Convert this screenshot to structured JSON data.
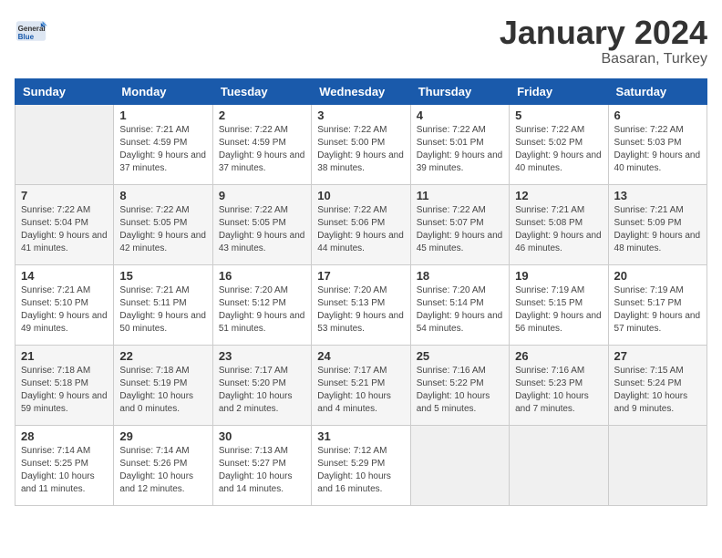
{
  "header": {
    "logo": {
      "general": "General",
      "blue": "Blue"
    },
    "title": "January 2024",
    "subtitle": "Basaran, Turkey"
  },
  "columns": [
    "Sunday",
    "Monday",
    "Tuesday",
    "Wednesday",
    "Thursday",
    "Friday",
    "Saturday"
  ],
  "weeks": [
    [
      {
        "day": "",
        "sunrise": "",
        "sunset": "",
        "daylight": ""
      },
      {
        "day": "1",
        "sunrise": "Sunrise: 7:21 AM",
        "sunset": "Sunset: 4:59 PM",
        "daylight": "Daylight: 9 hours and 37 minutes."
      },
      {
        "day": "2",
        "sunrise": "Sunrise: 7:22 AM",
        "sunset": "Sunset: 4:59 PM",
        "daylight": "Daylight: 9 hours and 37 minutes."
      },
      {
        "day": "3",
        "sunrise": "Sunrise: 7:22 AM",
        "sunset": "Sunset: 5:00 PM",
        "daylight": "Daylight: 9 hours and 38 minutes."
      },
      {
        "day": "4",
        "sunrise": "Sunrise: 7:22 AM",
        "sunset": "Sunset: 5:01 PM",
        "daylight": "Daylight: 9 hours and 39 minutes."
      },
      {
        "day": "5",
        "sunrise": "Sunrise: 7:22 AM",
        "sunset": "Sunset: 5:02 PM",
        "daylight": "Daylight: 9 hours and 40 minutes."
      },
      {
        "day": "6",
        "sunrise": "Sunrise: 7:22 AM",
        "sunset": "Sunset: 5:03 PM",
        "daylight": "Daylight: 9 hours and 40 minutes."
      }
    ],
    [
      {
        "day": "7",
        "sunrise": "Sunrise: 7:22 AM",
        "sunset": "Sunset: 5:04 PM",
        "daylight": "Daylight: 9 hours and 41 minutes."
      },
      {
        "day": "8",
        "sunrise": "Sunrise: 7:22 AM",
        "sunset": "Sunset: 5:05 PM",
        "daylight": "Daylight: 9 hours and 42 minutes."
      },
      {
        "day": "9",
        "sunrise": "Sunrise: 7:22 AM",
        "sunset": "Sunset: 5:05 PM",
        "daylight": "Daylight: 9 hours and 43 minutes."
      },
      {
        "day": "10",
        "sunrise": "Sunrise: 7:22 AM",
        "sunset": "Sunset: 5:06 PM",
        "daylight": "Daylight: 9 hours and 44 minutes."
      },
      {
        "day": "11",
        "sunrise": "Sunrise: 7:22 AM",
        "sunset": "Sunset: 5:07 PM",
        "daylight": "Daylight: 9 hours and 45 minutes."
      },
      {
        "day": "12",
        "sunrise": "Sunrise: 7:21 AM",
        "sunset": "Sunset: 5:08 PM",
        "daylight": "Daylight: 9 hours and 46 minutes."
      },
      {
        "day": "13",
        "sunrise": "Sunrise: 7:21 AM",
        "sunset": "Sunset: 5:09 PM",
        "daylight": "Daylight: 9 hours and 48 minutes."
      }
    ],
    [
      {
        "day": "14",
        "sunrise": "Sunrise: 7:21 AM",
        "sunset": "Sunset: 5:10 PM",
        "daylight": "Daylight: 9 hours and 49 minutes."
      },
      {
        "day": "15",
        "sunrise": "Sunrise: 7:21 AM",
        "sunset": "Sunset: 5:11 PM",
        "daylight": "Daylight: 9 hours and 50 minutes."
      },
      {
        "day": "16",
        "sunrise": "Sunrise: 7:20 AM",
        "sunset": "Sunset: 5:12 PM",
        "daylight": "Daylight: 9 hours and 51 minutes."
      },
      {
        "day": "17",
        "sunrise": "Sunrise: 7:20 AM",
        "sunset": "Sunset: 5:13 PM",
        "daylight": "Daylight: 9 hours and 53 minutes."
      },
      {
        "day": "18",
        "sunrise": "Sunrise: 7:20 AM",
        "sunset": "Sunset: 5:14 PM",
        "daylight": "Daylight: 9 hours and 54 minutes."
      },
      {
        "day": "19",
        "sunrise": "Sunrise: 7:19 AM",
        "sunset": "Sunset: 5:15 PM",
        "daylight": "Daylight: 9 hours and 56 minutes."
      },
      {
        "day": "20",
        "sunrise": "Sunrise: 7:19 AM",
        "sunset": "Sunset: 5:17 PM",
        "daylight": "Daylight: 9 hours and 57 minutes."
      }
    ],
    [
      {
        "day": "21",
        "sunrise": "Sunrise: 7:18 AM",
        "sunset": "Sunset: 5:18 PM",
        "daylight": "Daylight: 9 hours and 59 minutes."
      },
      {
        "day": "22",
        "sunrise": "Sunrise: 7:18 AM",
        "sunset": "Sunset: 5:19 PM",
        "daylight": "Daylight: 10 hours and 0 minutes."
      },
      {
        "day": "23",
        "sunrise": "Sunrise: 7:17 AM",
        "sunset": "Sunset: 5:20 PM",
        "daylight": "Daylight: 10 hours and 2 minutes."
      },
      {
        "day": "24",
        "sunrise": "Sunrise: 7:17 AM",
        "sunset": "Sunset: 5:21 PM",
        "daylight": "Daylight: 10 hours and 4 minutes."
      },
      {
        "day": "25",
        "sunrise": "Sunrise: 7:16 AM",
        "sunset": "Sunset: 5:22 PM",
        "daylight": "Daylight: 10 hours and 5 minutes."
      },
      {
        "day": "26",
        "sunrise": "Sunrise: 7:16 AM",
        "sunset": "Sunset: 5:23 PM",
        "daylight": "Daylight: 10 hours and 7 minutes."
      },
      {
        "day": "27",
        "sunrise": "Sunrise: 7:15 AM",
        "sunset": "Sunset: 5:24 PM",
        "daylight": "Daylight: 10 hours and 9 minutes."
      }
    ],
    [
      {
        "day": "28",
        "sunrise": "Sunrise: 7:14 AM",
        "sunset": "Sunset: 5:25 PM",
        "daylight": "Daylight: 10 hours and 11 minutes."
      },
      {
        "day": "29",
        "sunrise": "Sunrise: 7:14 AM",
        "sunset": "Sunset: 5:26 PM",
        "daylight": "Daylight: 10 hours and 12 minutes."
      },
      {
        "day": "30",
        "sunrise": "Sunrise: 7:13 AM",
        "sunset": "Sunset: 5:27 PM",
        "daylight": "Daylight: 10 hours and 14 minutes."
      },
      {
        "day": "31",
        "sunrise": "Sunrise: 7:12 AM",
        "sunset": "Sunset: 5:29 PM",
        "daylight": "Daylight: 10 hours and 16 minutes."
      },
      {
        "day": "",
        "sunrise": "",
        "sunset": "",
        "daylight": ""
      },
      {
        "day": "",
        "sunrise": "",
        "sunset": "",
        "daylight": ""
      },
      {
        "day": "",
        "sunrise": "",
        "sunset": "",
        "daylight": ""
      }
    ]
  ]
}
